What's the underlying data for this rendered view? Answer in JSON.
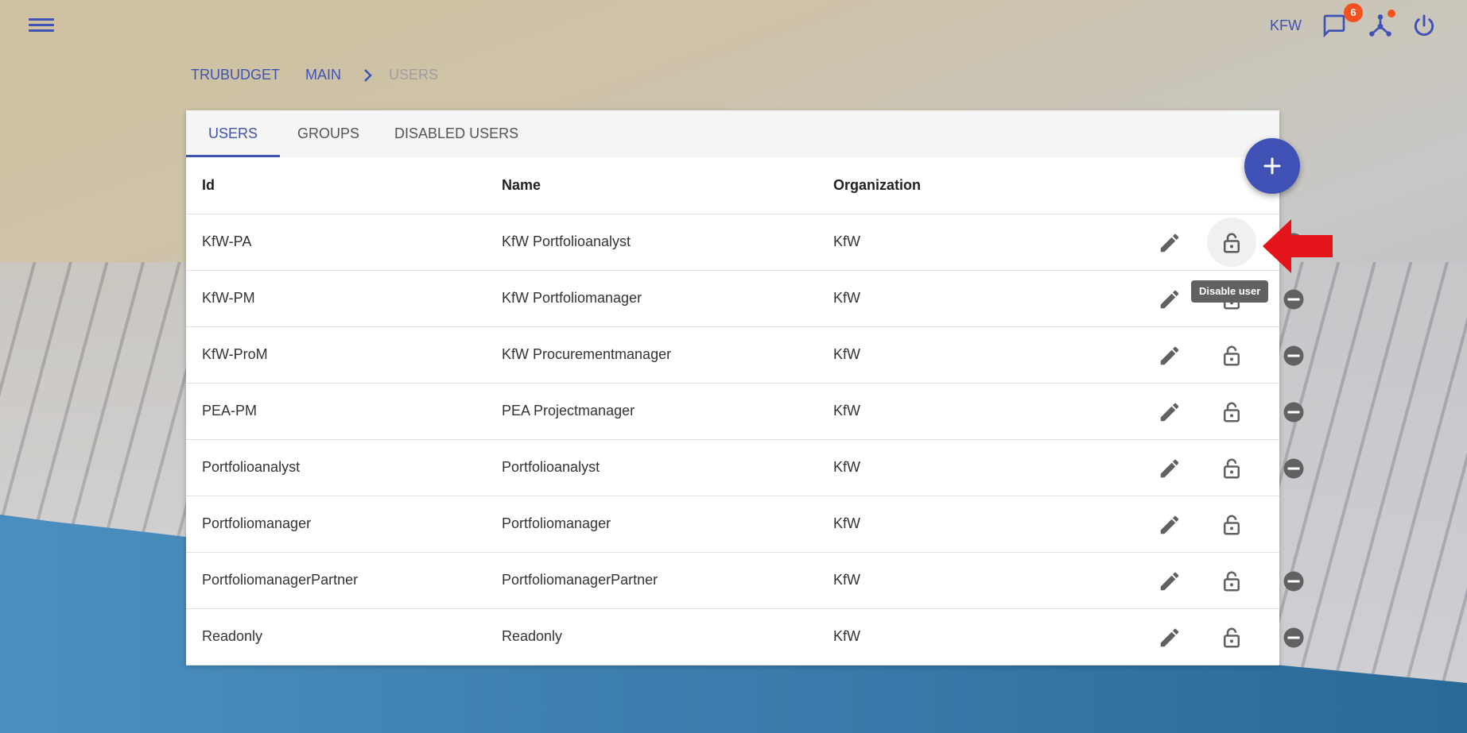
{
  "header": {
    "org": "KFW",
    "notification_count": "6",
    "icons": [
      "menu-icon",
      "chat-icon",
      "network-icon",
      "power-icon"
    ]
  },
  "breadcrumb": [
    "TRUBUDGET",
    "MAIN",
    "USERS"
  ],
  "tabs": [
    "USERS",
    "GROUPS",
    "DISABLED USERS"
  ],
  "table": {
    "headers": [
      "Id",
      "Name",
      "Organization"
    ],
    "rows": [
      {
        "id": "KfW-PA",
        "name": "KfW Portfolioanalyst",
        "org": "KfW",
        "can_disable": true
      },
      {
        "id": "KfW-PM",
        "name": "KfW Portfoliomanager",
        "org": "KfW",
        "can_disable": true
      },
      {
        "id": "KfW-ProM",
        "name": "KfW Procurementmanager",
        "org": "KfW",
        "can_disable": true
      },
      {
        "id": "PEA-PM",
        "name": "PEA Projectmanager",
        "org": "KfW",
        "can_disable": true
      },
      {
        "id": "Portfolioanalyst",
        "name": "Portfolioanalyst",
        "org": "KfW",
        "can_disable": true
      },
      {
        "id": "Portfoliomanager",
        "name": "Portfoliomanager",
        "org": "KfW",
        "can_disable": false
      },
      {
        "id": "PortfoliomanagerPartner",
        "name": "PortfoliomanagerPartner",
        "org": "KfW",
        "can_disable": true
      },
      {
        "id": "Readonly",
        "name": "Readonly",
        "org": "KfW",
        "can_disable": true
      }
    ]
  },
  "tooltip": "Disable user",
  "colors": {
    "primary": "#3f51b5",
    "badge": "#f4511e",
    "arrow": "#e3151a",
    "icon": "#616161"
  }
}
